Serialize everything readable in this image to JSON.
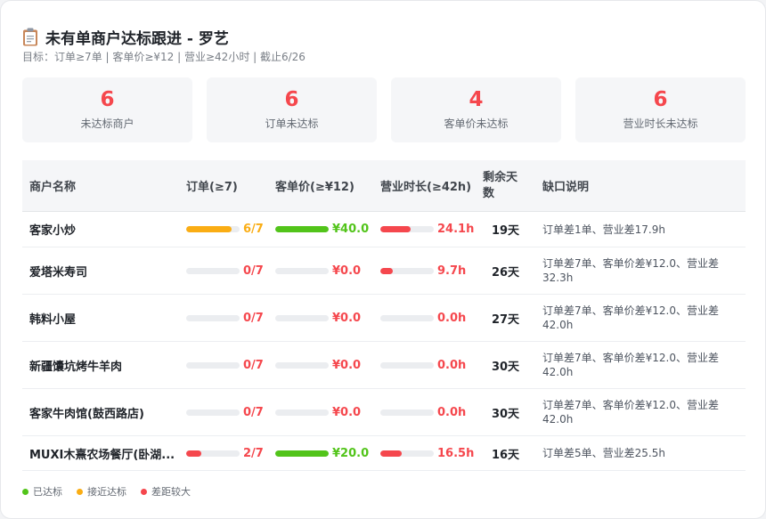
{
  "header": {
    "title": "未有单商户达标跟进 - 罗艺",
    "subtitle": "目标：订单≥7单 | 客单价≥¥12 | 营业≥42小时 | 截止6/26"
  },
  "stats": [
    {
      "value": "6",
      "label": "未达标商户"
    },
    {
      "value": "6",
      "label": "订单未达标"
    },
    {
      "value": "4",
      "label": "客单价未达标"
    },
    {
      "value": "6",
      "label": "营业时长未达标"
    }
  ],
  "table": {
    "headers": {
      "name": "商户名称",
      "orders": "订单(≥7)",
      "price": "客单价(≥¥12)",
      "hours": "营业时长(≥42h)",
      "days_line1": "剩余天",
      "days_line2": "数",
      "note": "缺口说明"
    },
    "rows": [
      {
        "name": "客家小炒",
        "orders": {
          "text": "6/7",
          "level": 0.857,
          "status": "near"
        },
        "price": {
          "text": "¥40.0",
          "level": 1.0,
          "status": "ok"
        },
        "hours": {
          "text": "24.1h",
          "level": 0.574,
          "status": "bad"
        },
        "days": "19天",
        "note": "订单差1单、营业差17.9h"
      },
      {
        "name": "爱塔米寿司",
        "orders": {
          "text": "0/7",
          "level": 0,
          "status": "bad"
        },
        "price": {
          "text": "¥0.0",
          "level": 0,
          "status": "bad"
        },
        "hours": {
          "text": "9.7h",
          "level": 0.23,
          "status": "bad"
        },
        "days": "26天",
        "note": "订单差7单、客单价差¥12.0、营业差32.3h"
      },
      {
        "name": "韩料小屋",
        "orders": {
          "text": "0/7",
          "level": 0,
          "status": "bad"
        },
        "price": {
          "text": "¥0.0",
          "level": 0,
          "status": "bad"
        },
        "hours": {
          "text": "0.0h",
          "level": 0,
          "status": "bad"
        },
        "days": "27天",
        "note": "订单差7单、客单价差¥12.0、营业差42.0h"
      },
      {
        "name": "新疆馕坑烤牛羊肉",
        "orders": {
          "text": "0/7",
          "level": 0,
          "status": "bad"
        },
        "price": {
          "text": "¥0.0",
          "level": 0,
          "status": "bad"
        },
        "hours": {
          "text": "0.0h",
          "level": 0,
          "status": "bad"
        },
        "days": "30天",
        "note": "订单差7单、客单价差¥12.0、营业差42.0h"
      },
      {
        "name": "客家牛肉馆(鼓西路店)",
        "orders": {
          "text": "0/7",
          "level": 0,
          "status": "bad"
        },
        "price": {
          "text": "¥0.0",
          "level": 0,
          "status": "bad"
        },
        "hours": {
          "text": "0.0h",
          "level": 0,
          "status": "bad"
        },
        "days": "30天",
        "note": "订单差7单、客单价差¥12.0、营业差42.0h"
      },
      {
        "name": "MUXI木熹农场餐厅(卧湖...",
        "orders": {
          "text": "2/7",
          "level": 0.286,
          "status": "bad"
        },
        "price": {
          "text": "¥20.0",
          "level": 1.0,
          "status": "ok"
        },
        "hours": {
          "text": "16.5h",
          "level": 0.393,
          "status": "bad"
        },
        "days": "16天",
        "note": "订单差5单、营业差25.5h"
      }
    ]
  },
  "legend": [
    {
      "label": "已达标",
      "status": "ok"
    },
    {
      "label": "接近达标",
      "status": "near"
    },
    {
      "label": "差距较大",
      "status": "bad"
    }
  ],
  "colors": {
    "ok": "#52c41a",
    "near": "#faad14",
    "bad": "#f5474d",
    "track": "#ebedf0"
  }
}
